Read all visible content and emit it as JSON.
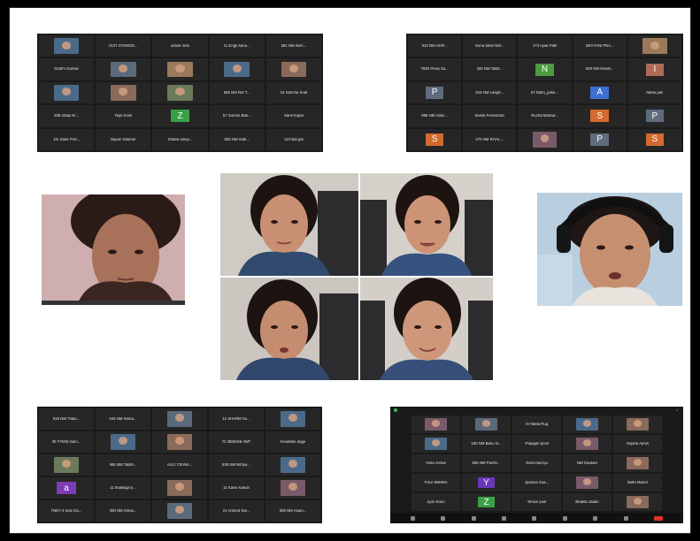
{
  "collage": {
    "panels": [
      {
        "id": "top-left",
        "rows": [
          [
            "",
            "0107 STANSIS...",
            "ashok nirla",
            "11 Engli Sanu...",
            "581 NM Sem..."
          ],
          [
            "Surbhi Gulmar",
            "",
            "",
            "",
            ""
          ],
          [
            "",
            "",
            "",
            "595 NM Ret T...",
            "24 Nimcha Sold"
          ],
          [
            "208 Abdul Kr...",
            "Tejel Kanli",
            "Z",
            "57 Sumon Bak...",
            "Sanil Kupal"
          ],
          [
            "111 Saint Prot...",
            "Dipum Dikeran",
            "Dhaba Adeyi...",
            "835 NM Sutti...",
            "110 Bat pal"
          ]
        ]
      },
      {
        "id": "top-right",
        "rows": [
          [
            "810 NM ADIF...",
            "Sona Sikar NM...",
            "173 Ayati Patil",
            "DEVYANI PEA...",
            ""
          ],
          [
            "7826 Privia Sa...",
            "505 NM Talibl...",
            "N",
            "650 NM Nandr...",
            "I"
          ],
          [
            "P",
            "519 NM Lasgrt...",
            "57 Nidhi_poke...",
            "A",
            "Nikita pan"
          ],
          [
            "985 NM Adan...",
            "Sanila Fernandez",
            "Rucha Mahad...",
            "S",
            "P"
          ],
          [
            "S",
            "270 NM RIYAL...",
            "",
            "P",
            "S"
          ]
        ]
      },
      {
        "id": "bottom-left",
        "rows": [
          [
            "515 NM Thaki...",
            "545 NM Ninha...",
            "",
            "12 SHARM Su...",
            ""
          ],
          [
            "30 TYMIS Sam...",
            "",
            "",
            "7C BEMIS8-JWF",
            "Kevalbhe duge"
          ],
          [
            "",
            "905 NM Talibh...",
            "A2c1 Chhhot...",
            "835 NM Nithya...",
            ""
          ],
          [
            "a",
            "11 thakkagl is...",
            "",
            "11 Kavin Kasuh",
            ""
          ],
          [
            "7NEY 4 Sani Da...",
            "300 NM Atmar...",
            "",
            "21 Armind Sal...",
            "505 NM Asam..."
          ]
        ]
      },
      {
        "id": "bottom-right",
        "rows": [
          [
            "",
            "",
            "Sr Nikita Rug",
            "",
            ""
          ],
          [
            "",
            "150 NM Banu N...",
            "Thaagat Ajmiri",
            "",
            "Srijane Ajmiri"
          ],
          [
            "Vishu Kshar",
            "505 NM Pachh...",
            "Sohil Harnya",
            "NM Gautam",
            ""
          ],
          [
            "THUI 5NMNA",
            "Y",
            "Jyotsna Sua...",
            "",
            "Nidhi Maren"
          ],
          [
            "Jyon Kuon",
            "Z",
            "Tehsin pusl",
            "Bhakta Jadari",
            ""
          ]
        ]
      }
    ],
    "tile_colors": {
      "Z": "#3aa048",
      "N": "#4c9c3e",
      "I": "#b06b57",
      "P": "#5e6c7d",
      "A": "#3d6fd0",
      "S": "#d36a2f",
      "a": "#7b3db5",
      "Y": "#6a36b8"
    },
    "accent_color": "#8fd14f",
    "end_button_color": "#d9332b"
  }
}
